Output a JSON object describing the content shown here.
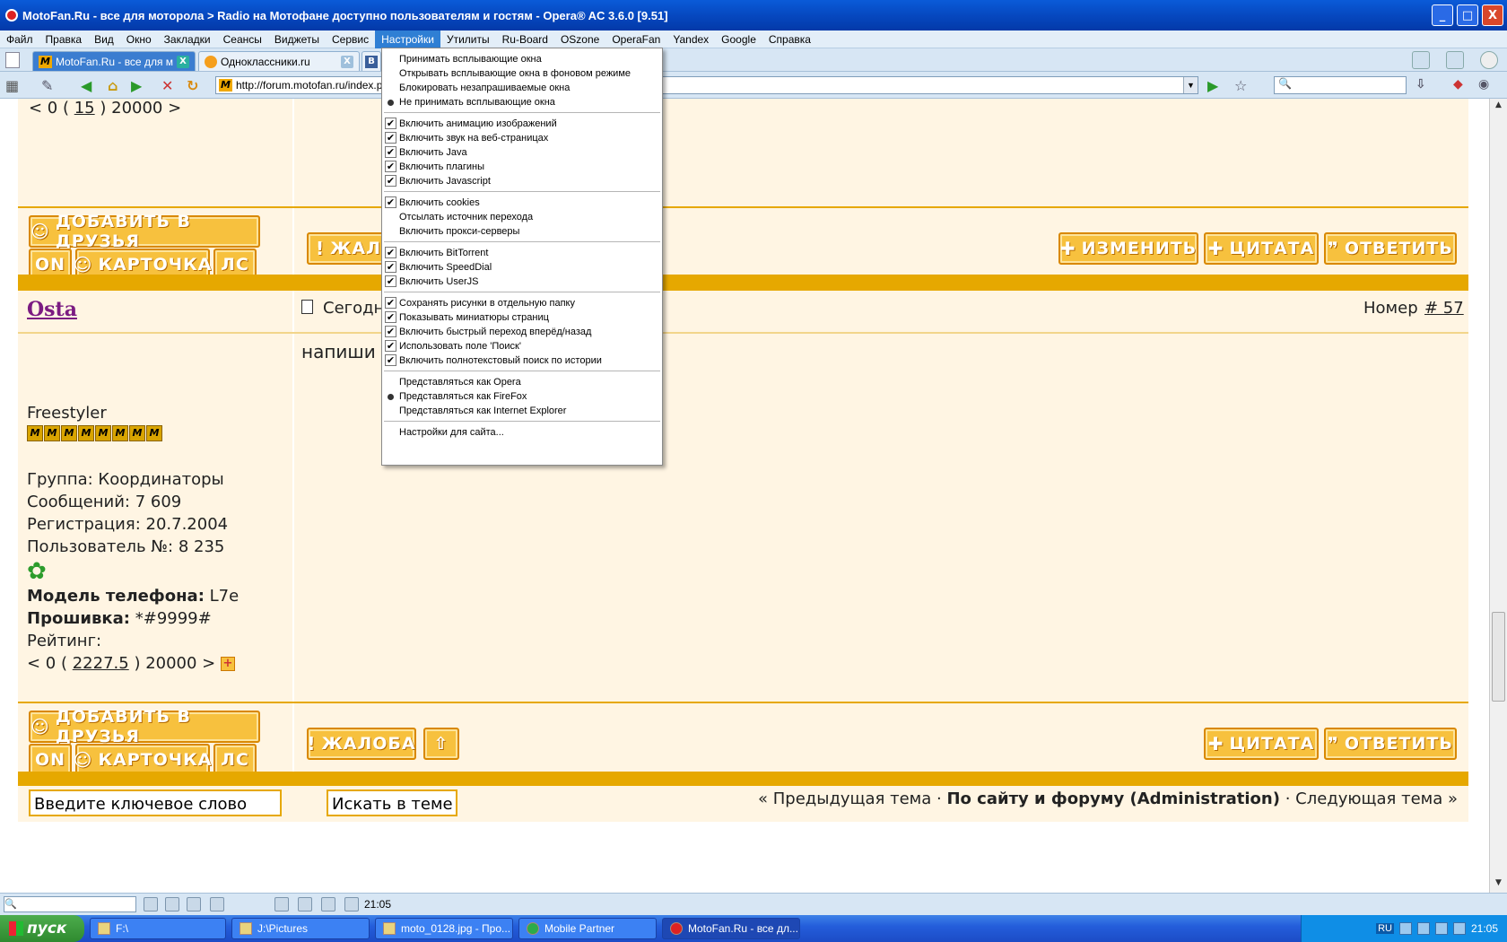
{
  "window": {
    "title": "MotoFan.Ru - все для моторола > Radio на Мотофане доступно пользователям и гостям - Opera® AC 3.6.0 [9.51]",
    "buttons": [
      "_",
      "□",
      "X"
    ]
  },
  "menubar": [
    "Файл",
    "Правка",
    "Вид",
    "Окно",
    "Закладки",
    "Сеансы",
    "Виджеты",
    "Сервис",
    "Настройки",
    "Утилиты",
    "Ru-Board",
    "OSzone",
    "OperaFan",
    "Yandex",
    "Google",
    "Справка"
  ],
  "tabs": [
    {
      "label": "MotoFan.Ru - все для м...",
      "close": "X"
    },
    {
      "label": "Одноклассники.ru",
      "close": "X"
    },
    {
      "label": ""
    }
  ],
  "address": {
    "url": "http://forum.motofan.ru/index.ph",
    "search_value": ""
  },
  "favicon_letters": {
    "motofan": "M",
    "vk": "B"
  },
  "page": {
    "rating_top": {
      "open": "< 0 (",
      "value": "15",
      "close": ") 20000 >"
    },
    "buttons": {
      "add_friend": "ДОБАВИТЬ В ДРУЗЬЯ",
      "on": "ON",
      "card": "КАРТОЧКА",
      "pm": "ЛС",
      "complaint": "ЖАЛОБА",
      "complaint_partial": "ЖАЛО",
      "edit": "ИЗМЕНИТЬ",
      "quote": "ЦИТАТА",
      "reply": "ОТВЕТИТЬ"
    },
    "post": {
      "username": "Osta",
      "date_partial": "Сегодн",
      "number_label": "Номер",
      "number": "# 57",
      "text_partial": "напиши",
      "user_title": "Freestyler",
      "stars": 8,
      "star_letter": "M",
      "group_label": "Группа:",
      "group": "Координаторы",
      "messages_label": "Сообщений:",
      "messages": "7 609",
      "registered_label": "Регистрация:",
      "registered": "20.7.2004",
      "user_no_label": "Пользователь №:",
      "user_no": "8 235",
      "phone_label": "Модель телефона:",
      "phone": "L7e",
      "firmware_label": "Прошивка:",
      "firmware": "*#9999#",
      "rating_label": "Рейтинг:",
      "rating_open": "< 0 (",
      "rating": "2227.5",
      "rating_close": ") 20000 >"
    },
    "bottom": {
      "search_input": "Введите ключевое слово",
      "search_button": "Искать в теме",
      "prev": "« Предыдущая тема",
      "dot1": "·",
      "site_link": "По сайту и форуму (Administration)",
      "dot2": "·",
      "next": "Следующая тема »"
    }
  },
  "settings_menu": {
    "items": [
      {
        "label": "Принимать всплывающие окна",
        "mark": "none"
      },
      {
        "label": "Открывать всплывающие окна в фоновом режиме",
        "mark": "none"
      },
      {
        "label": "Блокировать незапрашиваемые окна",
        "mark": "none"
      },
      {
        "label": "Не принимать всплывающие окна",
        "mark": "radio"
      },
      {
        "label": "Включить анимацию изображений",
        "mark": "check"
      },
      {
        "label": "Включить звук на веб-страницах",
        "mark": "check"
      },
      {
        "label": "Включить Java",
        "mark": "check"
      },
      {
        "label": "Включить плагины",
        "mark": "check"
      },
      {
        "label": "Включить Javascript",
        "mark": "check"
      },
      {
        "label": "Включить cookies",
        "mark": "check"
      },
      {
        "label": "Отсылать источник перехода",
        "mark": "none"
      },
      {
        "label": "Включить прокси-серверы",
        "mark": "none"
      },
      {
        "label": "Включить BitTorrent",
        "mark": "check"
      },
      {
        "label": "Включить SpeedDial",
        "mark": "check"
      },
      {
        "label": "Включить UserJS",
        "mark": "check"
      },
      {
        "label": "Сохранять рисунки в отдельную папку",
        "mark": "check"
      },
      {
        "label": "Показывать миниатюры страниц",
        "mark": "check"
      },
      {
        "label": "Включить быстрый переход вперёд/назад",
        "mark": "check"
      },
      {
        "label": "Использовать поле 'Поиск'",
        "mark": "check"
      },
      {
        "label": "Включить полнотекстовый поиск по истории",
        "mark": "check"
      },
      {
        "label": "Представляться как Opera",
        "mark": "none"
      },
      {
        "label": "Представляться как FireFox",
        "mark": "radio"
      },
      {
        "label": "Представляться как Internet Explorer",
        "mark": "none"
      },
      {
        "label": "Настройки для сайта...",
        "mark": "none"
      }
    ]
  },
  "statusbar": {
    "time": "21:05"
  },
  "taskbar": {
    "start": "пуск",
    "tasks": [
      "F:\\",
      "J:\\Pictures",
      "moto_0128.jpg - Про...",
      "Mobile Partner",
      "MotoFan.Ru - все дл..."
    ],
    "lang": "RU",
    "clock": "21:05"
  },
  "colors": {
    "accent": "#e6a800",
    "post_bg": "#fff5e3",
    "username": "#7b1b82",
    "button": "#f7c13e"
  }
}
